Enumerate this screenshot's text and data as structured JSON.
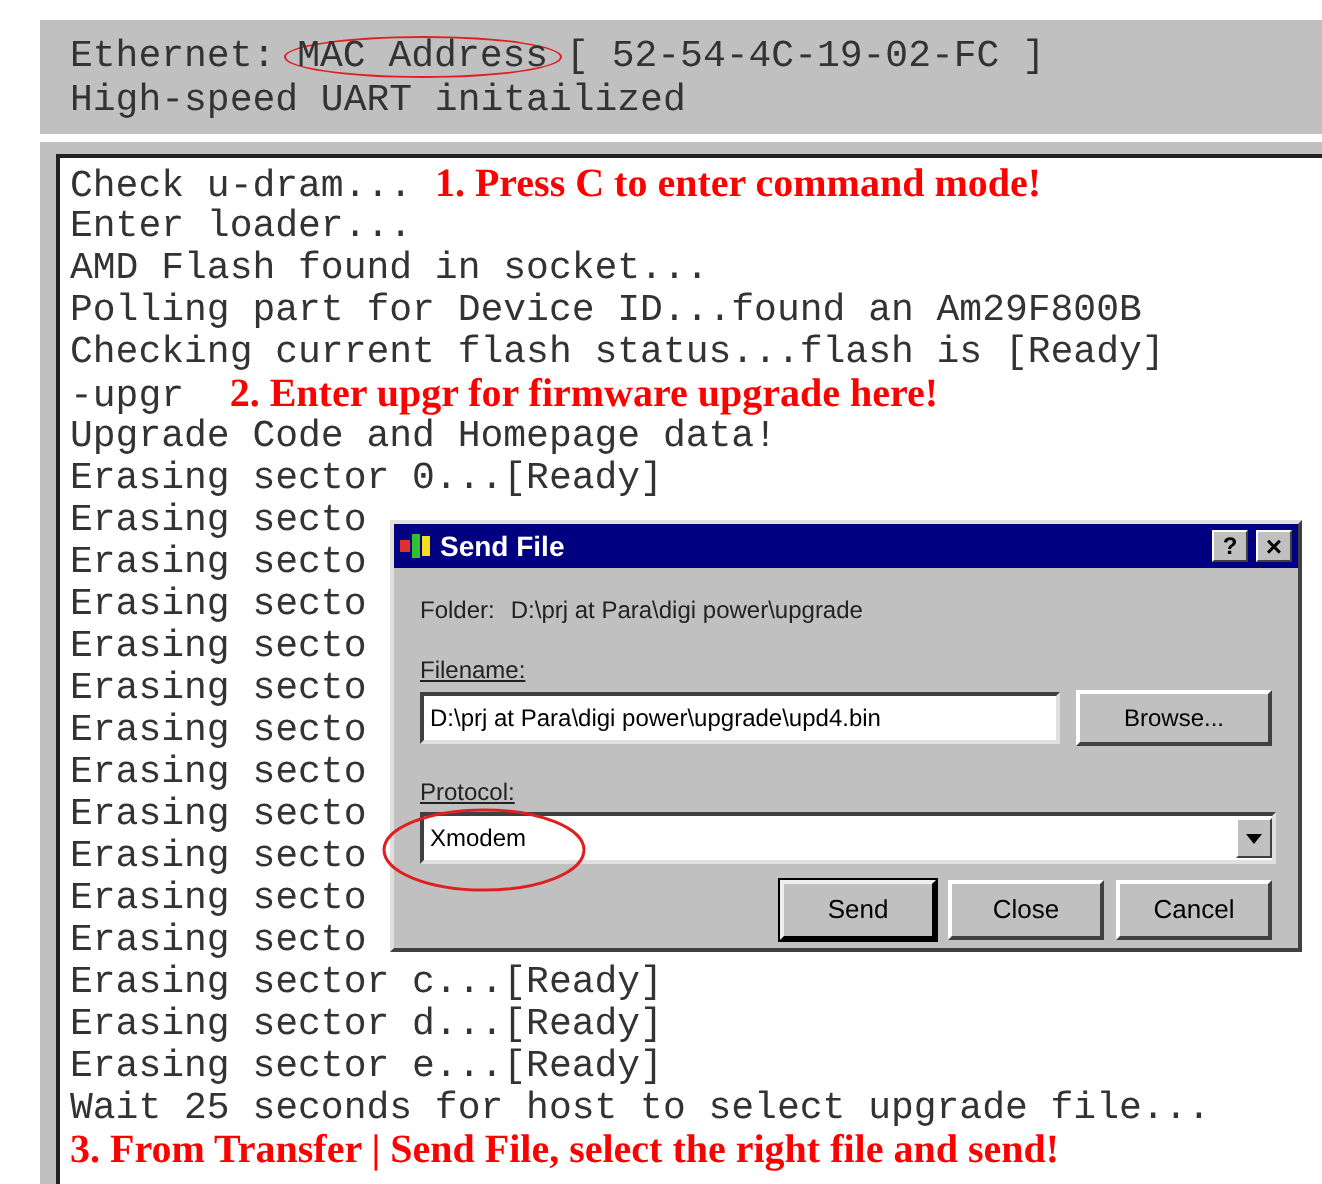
{
  "header": {
    "ethernet_label": "Ethernet:",
    "mac_label": "MAC Address",
    "mac_value": "[ 52-54-4C-19-02-FC ]",
    "status": "High-speed UART initailized"
  },
  "terminal": {
    "lines": [
      {
        "text": "Check u-dram... ",
        "note": "1. Press C to enter command mode!"
      },
      {
        "text": "Enter loader..."
      },
      {
        "text": "AMD Flash found in socket..."
      },
      {
        "text": "Polling part for Device ID...found an Am29F800B"
      },
      {
        "text": "Checking current flash status...flash is [Ready]"
      },
      {
        "text": "-upgr  ",
        "note": "2. Enter upgr for firmware upgrade here!"
      },
      {
        "text": "Upgrade Code and Homepage data!"
      },
      {
        "text": "Erasing sector 0...[Ready]"
      },
      {
        "text": "Erasing secto"
      },
      {
        "text": "Erasing secto"
      },
      {
        "text": "Erasing secto"
      },
      {
        "text": "Erasing secto"
      },
      {
        "text": "Erasing secto"
      },
      {
        "text": "Erasing secto"
      },
      {
        "text": "Erasing secto"
      },
      {
        "text": "Erasing secto"
      },
      {
        "text": "Erasing secto"
      },
      {
        "text": "Erasing secto"
      },
      {
        "text": "Erasing secto"
      },
      {
        "text": "Erasing sector c...[Ready]"
      },
      {
        "text": "Erasing sector d...[Ready]"
      },
      {
        "text": "Erasing sector e...[Ready]"
      },
      {
        "text": "Wait 25 seconds for host to select upgrade file..."
      },
      {
        "note": "3. From Transfer | Send File, select the right file and send!"
      }
    ]
  },
  "dialog": {
    "title": "Send File",
    "help": "?",
    "close": "×",
    "folder_label": "Folder:",
    "folder": "D:\\prj at Para\\digi power\\upgrade",
    "filename_label": "Filename:",
    "filename": "D:\\prj at Para\\digi power\\upgrade\\upd4.bin",
    "browse": "Browse...",
    "protocol_label": "Protocol:",
    "protocol": "Xmodem",
    "buttons": [
      {
        "label": "Send",
        "default": true
      },
      {
        "label": "Close",
        "default": false
      },
      {
        "label": "Cancel",
        "default": false
      }
    ]
  }
}
